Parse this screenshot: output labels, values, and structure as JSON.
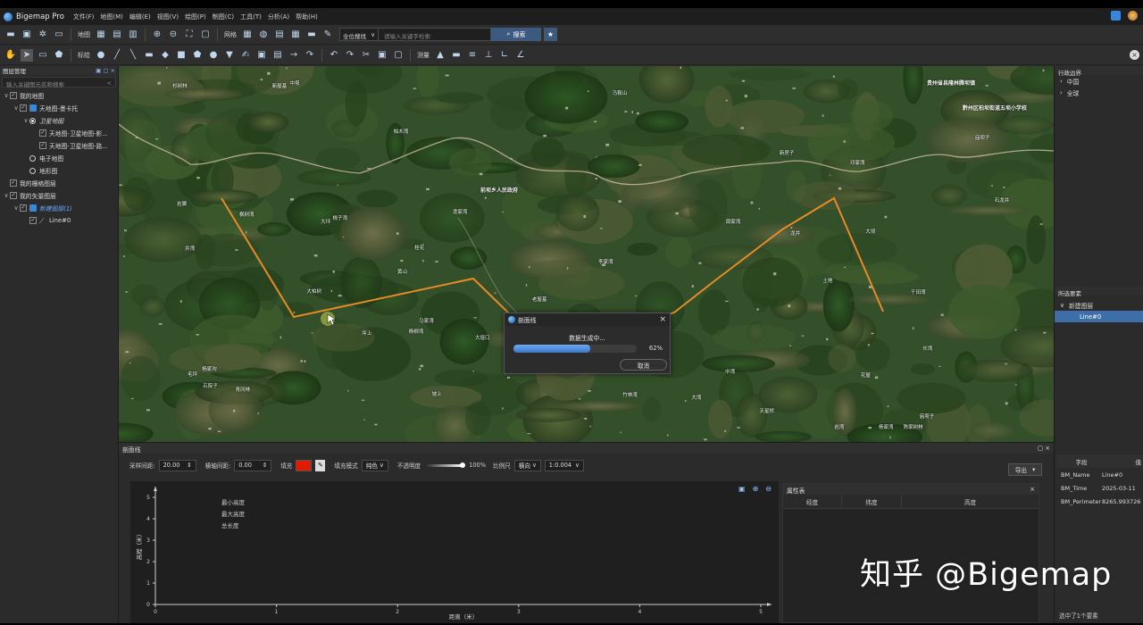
{
  "app": {
    "title": "Bigemap Pro"
  },
  "menu": [
    "文件(F)",
    "地图(M)",
    "编辑(E)",
    "视图(V)",
    "绘图(P)",
    "制图(C)",
    "工具(T)",
    "分析(A)",
    "帮助(H)"
  ],
  "toolbar1": {
    "map_label": "地图",
    "grid_label": "网格",
    "search_scope": "全位搜找",
    "search_placeholder": "请输入关键字检索",
    "search_button": "搜索"
  },
  "toolbar2": {
    "mark_label": "标绘",
    "measure_label": "测量"
  },
  "layers_panel": {
    "title": "图层管理",
    "filter_placeholder": "输入关键图元名称搜索",
    "items": [
      {
        "label": "我的地图",
        "level": 0,
        "kind": "checkbox",
        "chev": "∨"
      },
      {
        "label": "天地图-墨卡托",
        "level": 1,
        "kind": "checkbox",
        "chev": "∨"
      },
      {
        "label": "卫星地图",
        "level": 2,
        "kind": "radio-on",
        "chev": "∨"
      },
      {
        "label": "天地图-卫星地图-影...",
        "level": 3,
        "kind": "checkbox"
      },
      {
        "label": "天地图-卫星地图-路...",
        "level": 3,
        "kind": "checkbox"
      },
      {
        "label": "电子地图",
        "level": 2,
        "kind": "radio"
      },
      {
        "label": "地形图",
        "level": 2,
        "kind": "radio"
      },
      {
        "label": "我的栅格图层",
        "level": 0,
        "kind": "checkbox"
      },
      {
        "label": "我的矢量图层",
        "level": 0,
        "kind": "checkbox",
        "chev": "∨"
      },
      {
        "label": "新建图层(1)",
        "level": 1,
        "kind": "checkbox",
        "chev": "∨",
        "accent": true
      },
      {
        "label": "Line#0",
        "level": 2,
        "kind": "checkbox"
      }
    ]
  },
  "map_labels": [
    {
      "t": "老屋基"
    },
    {
      "t": "大坪"
    },
    {
      "t": "新屋基"
    },
    {
      "t": "土地"
    },
    {
      "t": "陈家树林"
    },
    {
      "t": "柏木湾"
    },
    {
      "t": "中山坡"
    },
    {
      "t": "黄山"
    },
    {
      "t": "杨柳湾"
    },
    {
      "t": "龙井"
    },
    {
      "t": "大坝"
    },
    {
      "t": "马鞍山"
    },
    {
      "t": "杉树林"
    },
    {
      "t": "岩湾"
    },
    {
      "t": "桂花"
    },
    {
      "t": "中湾"
    },
    {
      "t": "李家湾"
    },
    {
      "t": "石龙井"
    },
    {
      "t": "庙坝子"
    },
    {
      "t": "龙家湾"
    },
    {
      "t": "杨家湾"
    },
    {
      "t": "桃子湾"
    },
    {
      "t": "大湾"
    },
    {
      "t": "坪上"
    },
    {
      "t": "花屋"
    },
    {
      "t": "周家湾"
    },
    {
      "t": "竹林湾"
    },
    {
      "t": "杨家沟"
    },
    {
      "t": "邓家湾"
    },
    {
      "t": "毛坪"
    },
    {
      "t": "马家湾"
    },
    {
      "t": "大垭口"
    },
    {
      "t": "青冈林"
    },
    {
      "t": "长湾"
    },
    {
      "t": "新房子"
    },
    {
      "t": "岩脚"
    },
    {
      "t": "枫树湾"
    },
    {
      "t": "中坝"
    },
    {
      "t": "大柏树"
    },
    {
      "t": "坡上"
    },
    {
      "t": "井湾"
    },
    {
      "t": "庙坝子"
    },
    {
      "t": "干田湾"
    },
    {
      "t": "天星桥"
    },
    {
      "t": "下院子"
    },
    {
      "t": "石院子"
    }
  ],
  "map_poi": [
    "贵州省县隆林腾坝镇",
    "前坝乡人民政府",
    "黔州区柏坝街道五坝小学校"
  ],
  "dialog": {
    "title": "剖面线",
    "message": "数据生成中...",
    "progress": 0.62,
    "percent_text": "62%",
    "cancel": "取消"
  },
  "profile_panel": {
    "title": "剖面线",
    "sample_label": "采样间距:",
    "sample_value": "20.00",
    "hspacing_label": "横轴间距:",
    "hspacing_value": "0.00",
    "fill_label": "填充",
    "fill_color": "#e01b00",
    "fill_mode_label": "填充模式",
    "fill_mode_value": "纯色",
    "opacity_label": "不透明度",
    "opacity_value": 1.0,
    "opacity_text": "100%",
    "scale_label": "比例尺",
    "scale_dir": "横向",
    "scale_value": "1:0.004",
    "export_label": "导出",
    "chart_legend": [
      "最小高度",
      "最大高度",
      "总长度"
    ]
  },
  "chart_data": {
    "type": "line",
    "xlabel": "距离（米）",
    "ylabel": "高程（米）",
    "xlim": [
      0,
      5
    ],
    "ylim": [
      0,
      5
    ],
    "x_ticks": [
      "0",
      "1",
      "2",
      "3",
      "4",
      "5"
    ],
    "y_ticks": [
      "0",
      "1",
      "2",
      "3",
      "4",
      "5"
    ],
    "series": []
  },
  "attr_table": {
    "title": "属性表",
    "columns": [
      "经度",
      "纬度",
      "高度"
    ]
  },
  "selected_panel": {
    "admin_title": "行政边界",
    "admin_items": [
      "中国",
      "全球"
    ],
    "sel_title": "所选要素",
    "layer": "新建图层",
    "item": "Line#0"
  },
  "field_table": {
    "col1": "字段",
    "col2": "值",
    "rows": [
      [
        "BM_Name",
        "Line#0"
      ],
      [
        "BM_Time",
        "2025-03-11"
      ],
      [
        "BM_Perimeter",
        "8265.993726"
      ]
    ]
  },
  "status": "选中了1个要素",
  "watermark": "知乎 @Bigemap"
}
